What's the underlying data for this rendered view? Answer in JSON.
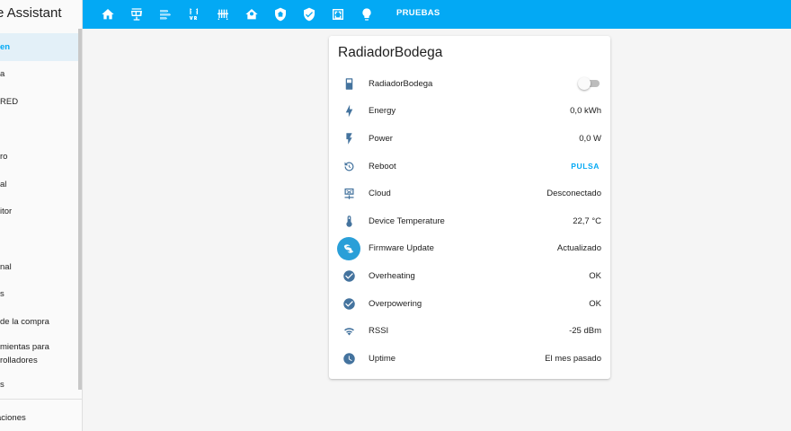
{
  "sidebar": {
    "title": "e Assistant",
    "items": [
      {
        "label": "en",
        "active": true
      },
      {
        "label": "a"
      },
      {
        "label": "RED"
      },
      {
        "label": ""
      },
      {
        "label": "ro"
      },
      {
        "label": "al"
      },
      {
        "label": "itor"
      },
      {
        "label": ""
      },
      {
        "label": "nal"
      },
      {
        "label": "s"
      },
      {
        "label": "de la compra"
      },
      {
        "line1": "mientas para",
        "line2": "rolladores"
      },
      {
        "label": "s"
      }
    ],
    "bottom_label": "aciones"
  },
  "topbar": {
    "icons": [
      "home-icon",
      "solar-panel-icon",
      "heat-pump-icon",
      "air-conditioner-icon",
      "radiator-icon",
      "home-outline-icon",
      "shield-home-icon",
      "shield-check-icon",
      "floor-plan-icon",
      "lightbulb-icon"
    ],
    "active_tab": "PRUEBAS"
  },
  "card": {
    "title": "RadiadorBodega",
    "rows": [
      {
        "label": "RadiadorBodega",
        "icon": "radiator-icon",
        "control": "toggle",
        "toggle_on": false
      },
      {
        "label": "Energy",
        "value": "0,0 kWh",
        "icon": "lightning-bolt-icon"
      },
      {
        "label": "Power",
        "value": "0,0 W",
        "icon": "flash-icon"
      },
      {
        "label": "Reboot",
        "value": "PULSA",
        "icon": "restart-icon",
        "control": "button"
      },
      {
        "label": "Cloud",
        "value": "Desconectado",
        "icon": "cloud-network-icon"
      },
      {
        "label": "Device Temperature",
        "value": "22,7 °C",
        "icon": "thermometer-icon"
      },
      {
        "label": "Firmware Update",
        "value": "Actualizado",
        "icon": "shelly-logo-icon"
      },
      {
        "label": "Overheating",
        "value": "OK",
        "icon": "check-circle-icon"
      },
      {
        "label": "Overpowering",
        "value": "OK",
        "icon": "check-circle-icon"
      },
      {
        "label": "RSSI",
        "value": "-25 dBm",
        "icon": "wifi-icon"
      },
      {
        "label": "Uptime",
        "value": "El mes pasado",
        "icon": "clock-icon"
      }
    ]
  },
  "colors": {
    "primary": "#03a9f4",
    "icon": "#44739e",
    "background": "#f5f5f5"
  }
}
